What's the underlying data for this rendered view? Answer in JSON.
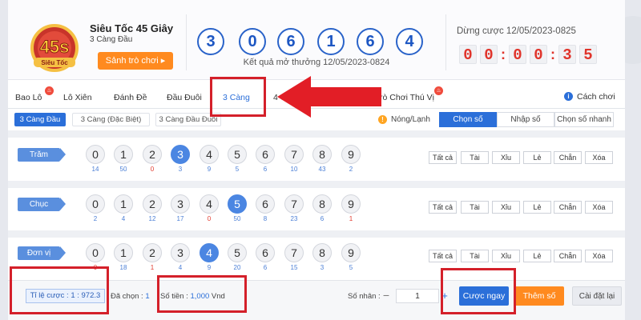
{
  "header": {
    "logo_text": "45s",
    "logo_sub": "Siêu Tốc",
    "title": "Siêu Tốc 45 Giây",
    "subtitle": "3 Càng Đầu",
    "lobby_button": "Sảnh trò chơi ▸",
    "result_digits": [
      "3",
      "0",
      "6",
      "1",
      "6",
      "4"
    ],
    "result_label": "Kết quả mở thưởng 12/05/2023-0824",
    "stop_label": "Dừng cược 12/05/2023-0825",
    "countdown": [
      "0",
      "0",
      "0",
      "0",
      "3",
      "5"
    ]
  },
  "tabs": {
    "items": [
      {
        "label": "Bao Lô",
        "hot": true
      },
      {
        "label": "Lô Xiên",
        "hot": false
      },
      {
        "label": "Đánh Đề",
        "hot": false
      },
      {
        "label": "Đầu Đuôi",
        "hot": false
      },
      {
        "label": "3 Càng",
        "hot": false,
        "active": true
      },
      {
        "label": "4 Càng",
        "hot": false
      },
      {
        "label": "Trò Chơi Thú Vị",
        "hot": true
      }
    ],
    "help": "Cách chơi"
  },
  "subtabs": [
    "3 Càng Đầu",
    "3 Càng (Đặc Biệt)",
    "3 Càng Đầu Đuôi"
  ],
  "hot_cold": "Nóng/Lạnh",
  "modes": [
    "Chọn số",
    "Nhập số",
    "Chọn số nhanh"
  ],
  "quick_buttons": [
    "Tất cả",
    "Tài",
    "Xỉu",
    "Lẻ",
    "Chẵn",
    "Xóa"
  ],
  "rows": [
    {
      "label": "Trăm",
      "selected": 3,
      "freq": [
        "14",
        "50",
        "0",
        "3",
        "9",
        "5",
        "6",
        "10",
        "43",
        "2"
      ]
    },
    {
      "label": "Chục",
      "selected": 5,
      "freq": [
        "2",
        "4",
        "12",
        "17",
        "0",
        "50",
        "8",
        "23",
        "6",
        "1"
      ]
    },
    {
      "label": "Đơn vị",
      "selected": 4,
      "freq": [
        "0",
        "18",
        "1",
        "4",
        "9",
        "20",
        "6",
        "15",
        "3",
        "5"
      ]
    }
  ],
  "footer": {
    "odds_label": "Tỉ lệ cược : ",
    "odds_value": "1 : 972.3",
    "selected_label": "Đã chọn : ",
    "selected_value": "1",
    "amount_label": "Số tiền : ",
    "amount_value": "1,000",
    "amount_unit": " Vnd",
    "multiplier_label": "Số nhân :",
    "multiplier_value": "1",
    "bet_now": "Cược ngay",
    "add_numbers": "Thêm số",
    "reset": "Cài đặt lại"
  },
  "colors": {
    "primary": "#2b6fd9",
    "accent_orange": "#ff8a1f",
    "countdown_red": "#e0342b",
    "annotation_red": "#d4202a"
  },
  "icons": [
    "hot-icon",
    "info-icon",
    "red-arrow-annotation"
  ]
}
